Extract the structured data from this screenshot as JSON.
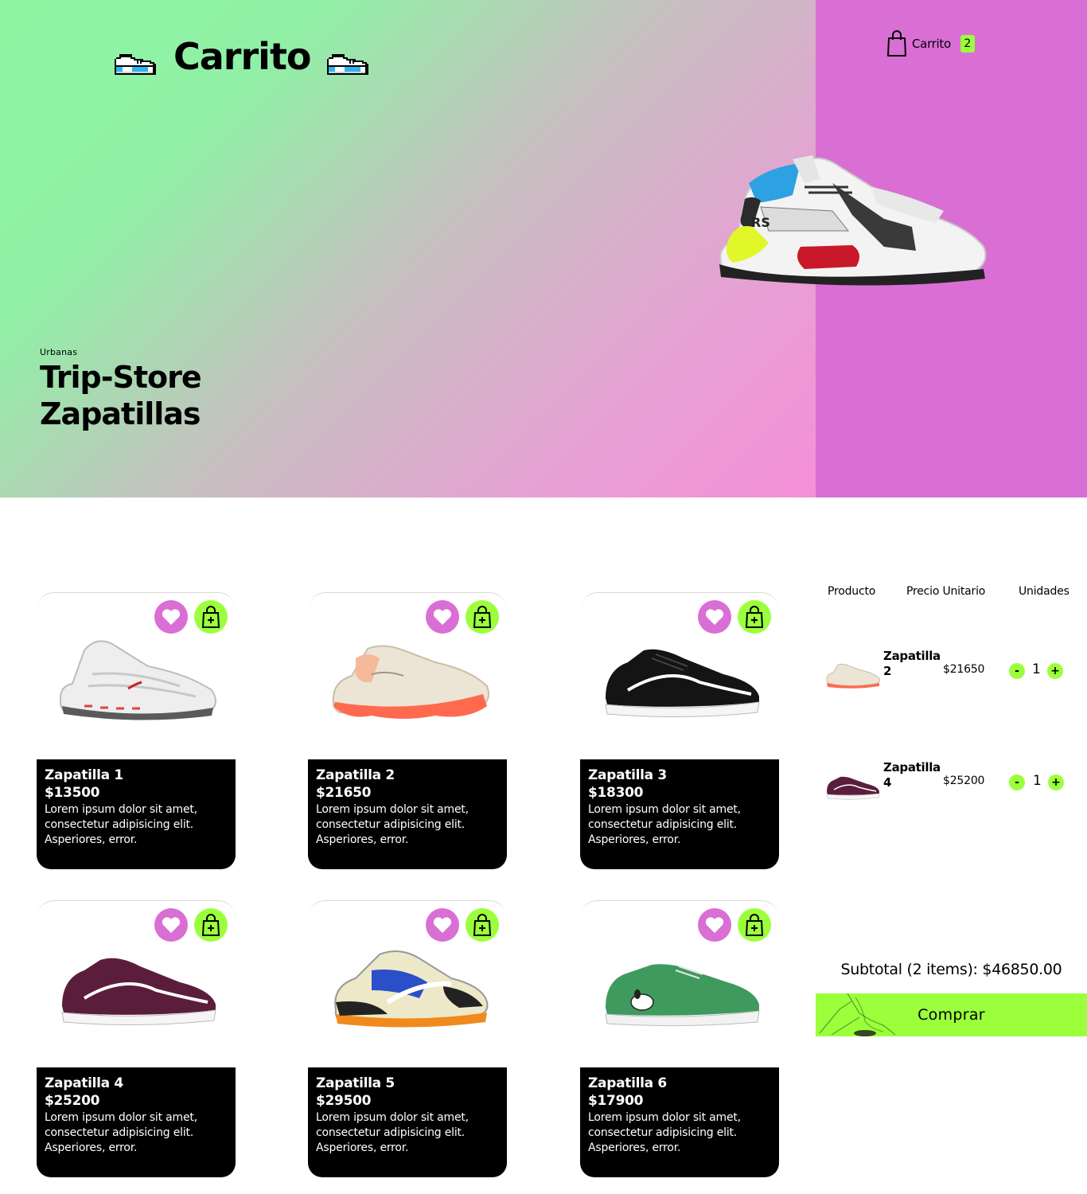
{
  "header": {
    "brand_title": "Carrito",
    "cart_label": "Carrito",
    "cart_count": "2",
    "icons": [
      "pixel-sneaker-icon",
      "shopping-bag-icon"
    ]
  },
  "hero": {
    "category": "Urbanas",
    "title_line1": "Trip-Store",
    "title_line2": "Zapatillas"
  },
  "products": [
    {
      "name": "Zapatilla 1",
      "price": "$13500",
      "description": "Lorem ipsum dolor sit amet, consectetur adipisicing elit. Asperiores, error."
    },
    {
      "name": "Zapatilla 2",
      "price": "$21650",
      "description": "Lorem ipsum dolor sit amet, consectetur adipisicing elit. Asperiores, error."
    },
    {
      "name": "Zapatilla 3",
      "price": "$18300",
      "description": "Lorem ipsum dolor sit amet, consectetur adipisicing elit. Asperiores, error."
    },
    {
      "name": "Zapatilla 4",
      "price": "$25200",
      "description": "Lorem ipsum dolor sit amet, consectetur adipisicing elit. Asperiores, error."
    },
    {
      "name": "Zapatilla 5",
      "price": "$29500",
      "description": "Lorem ipsum dolor sit amet, consectetur adipisicing elit. Asperiores, error."
    },
    {
      "name": "Zapatilla 6",
      "price": "$17900",
      "description": "Lorem ipsum dolor sit amet, consectetur adipisicing elit. Asperiores, error."
    }
  ],
  "cart": {
    "headers": {
      "product": "Producto",
      "unit_price": "Precio Unitario",
      "units": "Unidades"
    },
    "items": [
      {
        "name_line1": "Zapatilla",
        "name_line2": "2",
        "price": "$21650",
        "qty": "1",
        "minus": "-",
        "plus": "+"
      },
      {
        "name_line1": "Zapatilla",
        "name_line2": "4",
        "price": "$25200",
        "qty": "1",
        "minus": "-",
        "plus": "+"
      }
    ],
    "subtotal": "Subtotal (2 items): $46850.00",
    "buy_label": "Comprar"
  },
  "colors": {
    "accent_green": "#9bff3c",
    "accent_pink": "#d96fd4",
    "hero_gradient_start": "#8ff5a2",
    "hero_gradient_end": "#f590d8"
  }
}
